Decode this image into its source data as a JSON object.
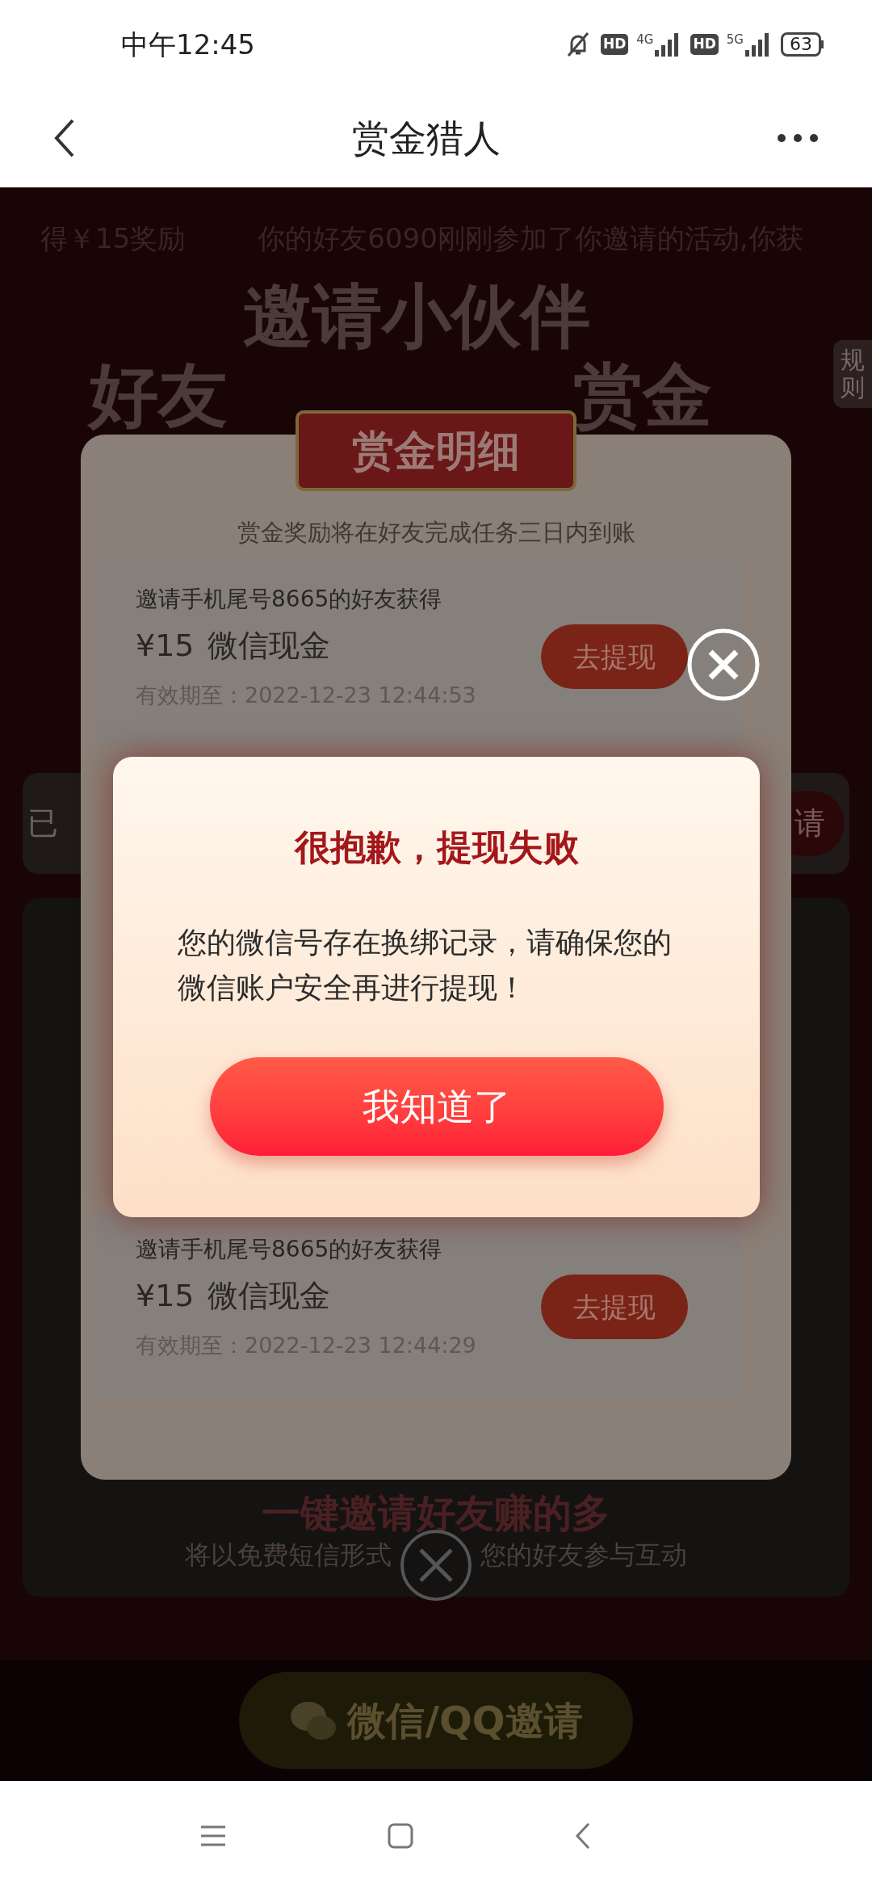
{
  "status_bar": {
    "time": "中午12:45",
    "hd_1": "HD",
    "network_1": "4G",
    "hd_2": "HD",
    "network_2": "5G",
    "battery": "63"
  },
  "header": {
    "title": "赏金猎人"
  },
  "page": {
    "ticker": [
      "得￥15奖励",
      "你的好友6090刚刚参加了你邀请的活动,你获"
    ],
    "banner_line_1": "邀请小伙伴",
    "banner_line_2": [
      "好友",
      "赏金"
    ],
    "rules_tab": "规则",
    "invited_label": "已",
    "invite_fragment": "请",
    "promo_title": "一键邀请好友赚的多",
    "promo_subtitle": [
      "将以免费短信形式",
      "您的好友参与互动"
    ],
    "share_button": "微信/QQ邀请"
  },
  "details_modal": {
    "title": "赏金明细",
    "note": "赏金奖励将在好友完成任务三日内到账",
    "rewards": [
      {
        "description": "邀请手机尾号8665的好友获得",
        "amount": "¥15",
        "reward_type": "微信现金",
        "expiry": "有效期至：2022-12-23 12:44:53",
        "button": "去提现"
      },
      {
        "description": "邀请手机尾号8665的好友获得",
        "amount": "¥15",
        "reward_type": "微信现金",
        "expiry": "有效期至：2022-12-23 12:44:29",
        "button": "去提现"
      }
    ]
  },
  "alert_dialog": {
    "title": "很抱歉，提现失败",
    "message": "您的微信号存在换绑记录，请确保您的微信账户安全再进行提现！",
    "button": "我知道了"
  }
}
